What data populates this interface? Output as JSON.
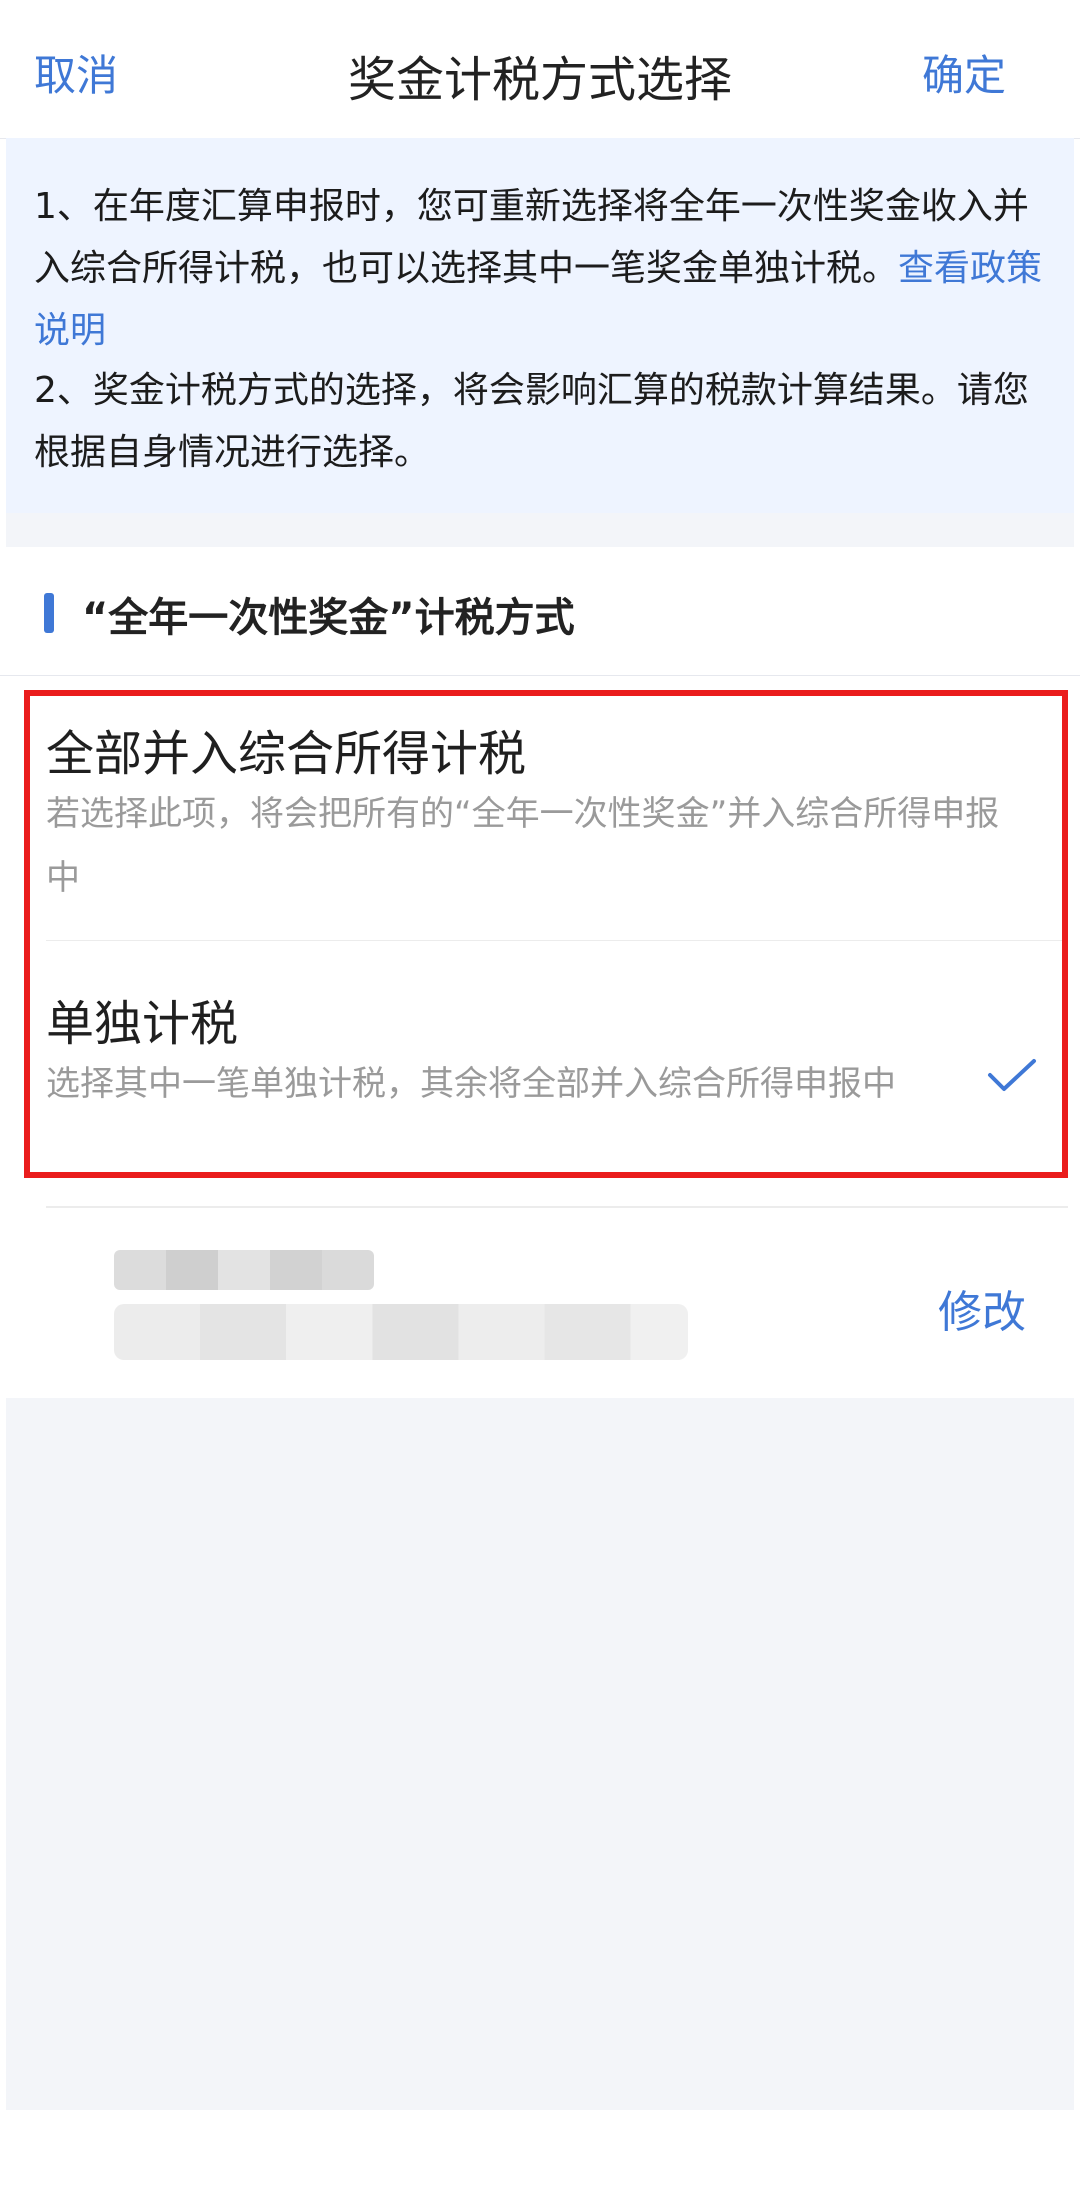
{
  "nav": {
    "cancel": "取消",
    "title": "奖金计税方式选择",
    "confirm": "确定"
  },
  "notice": {
    "p1_text": "1、在年度汇算申报时，您可重新选择将全年一次性奖金收入并入综合所得计税，也可以选择其中一笔奖金单独计税。",
    "p1_link": "查看政策说明",
    "p2_text": "2、奖金计税方式的选择，将会影响汇算的税款计算结果。请您根据自身情况进行选择。"
  },
  "section": {
    "title": "“全年一次性奖金”计税方式"
  },
  "options": [
    {
      "title": "全部并入综合所得计税",
      "desc": "若选择此项，将会把所有的“全年一次性奖金”并入综合所得申报中",
      "selected": false
    },
    {
      "title": "单独计税",
      "desc": "选择其中一笔单独计税，其余将全部并入综合所得申报中",
      "selected": true
    }
  ],
  "record": {
    "modify": "修改"
  },
  "colors": {
    "accent": "#3f78d6",
    "highlight": "#ea1d1d",
    "notice_bg": "#eef4ff"
  },
  "icons": {
    "selected_check": "checkmark-icon"
  }
}
